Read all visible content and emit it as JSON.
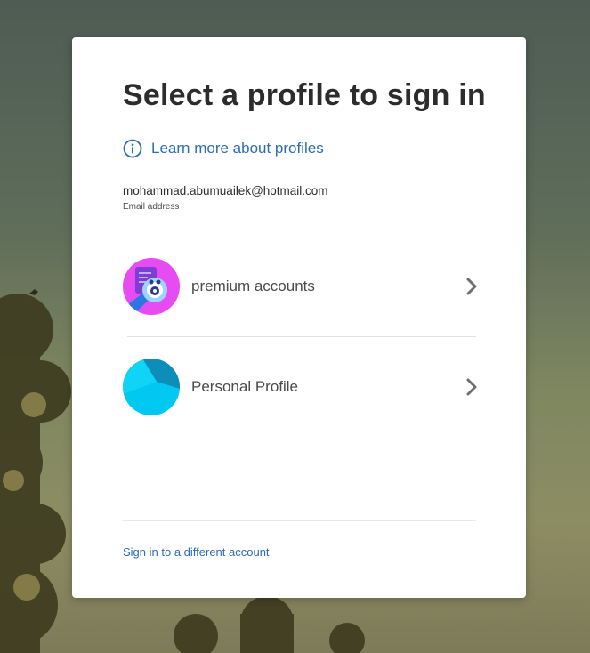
{
  "page": {
    "title": "Select a profile to sign in",
    "learn_more": "Learn more about profiles",
    "email": "mohammad.abumuailek@hotmail.com",
    "email_label": "Email address"
  },
  "profiles": [
    {
      "name": "premium accounts",
      "icon": "premium-accounts-avatar",
      "accent": "#e64cf2"
    },
    {
      "name": "Personal Profile",
      "icon": "personal-profile-avatar",
      "accent": "#00c8f0"
    }
  ],
  "footer": {
    "switch_account": "Sign in to a different account"
  },
  "colors": {
    "link": "#2d6db5",
    "title": "#2c2c2c",
    "card": "#ffffff"
  }
}
